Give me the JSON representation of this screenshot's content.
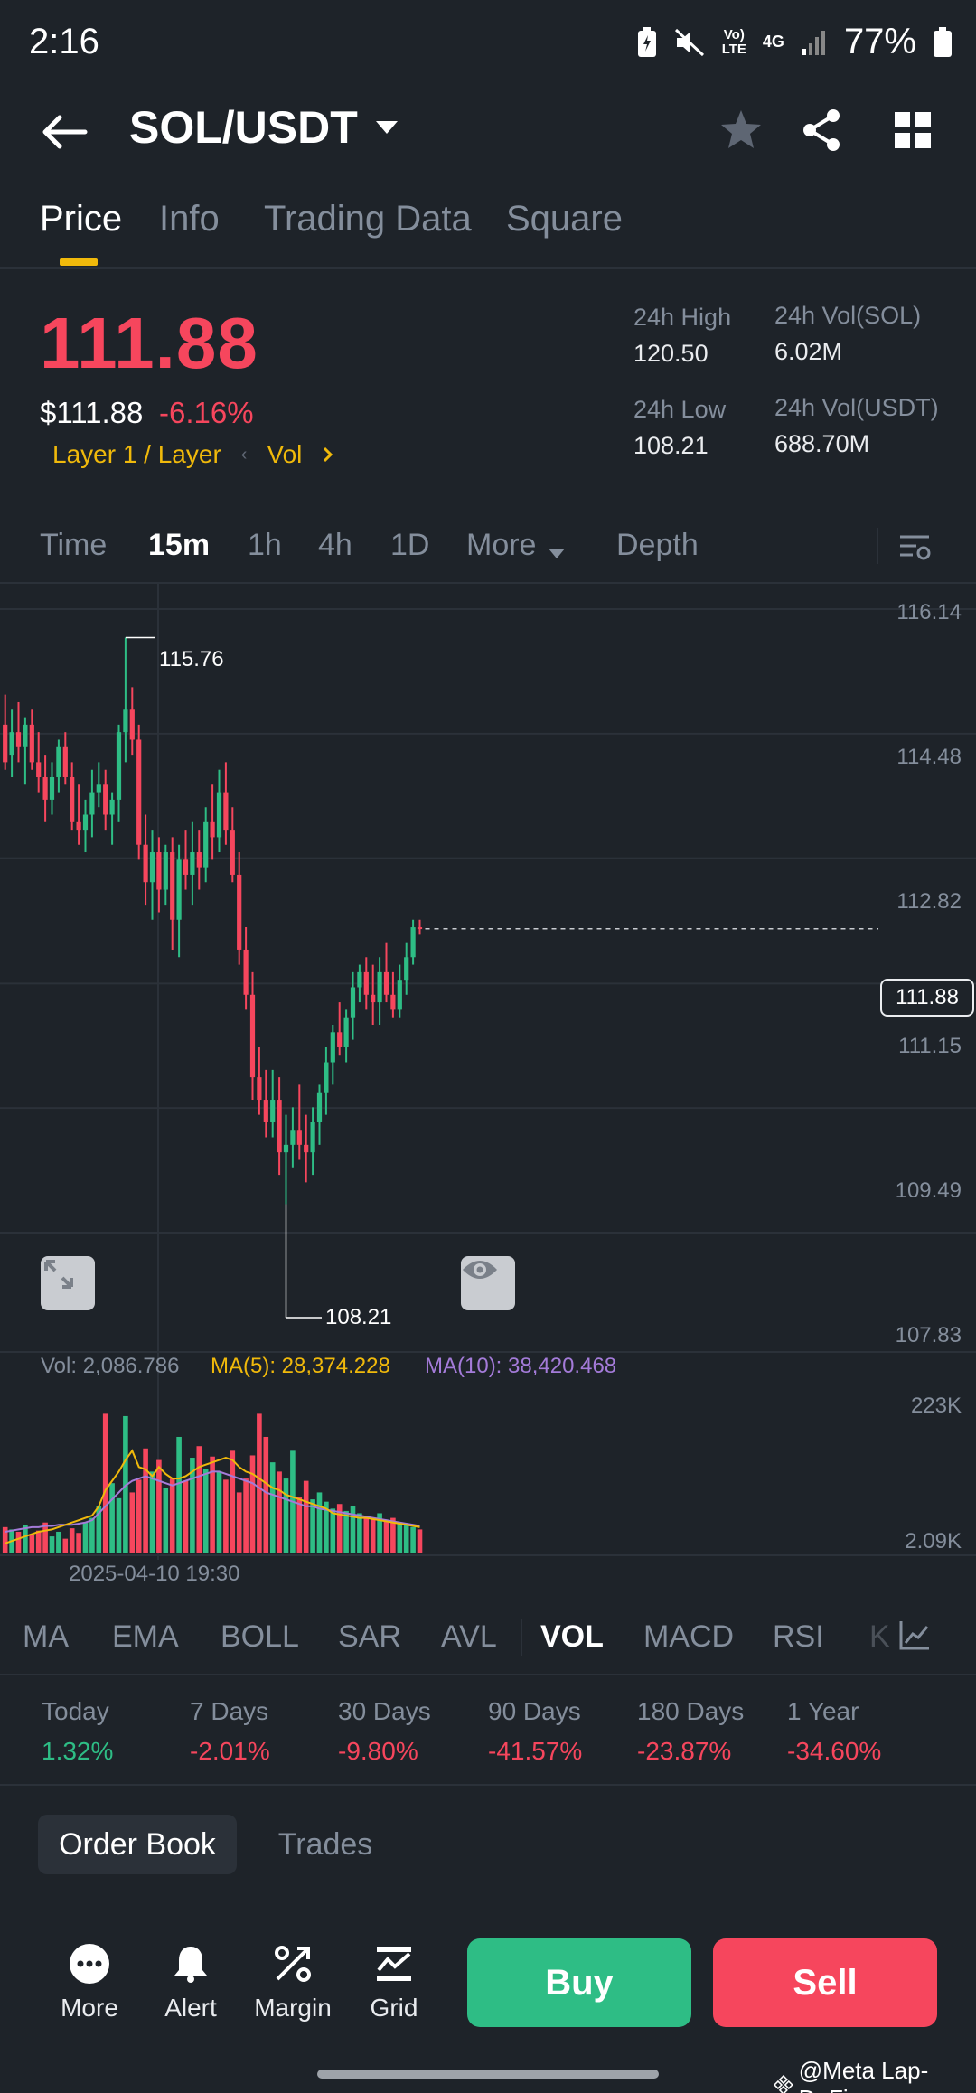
{
  "status_bar": {
    "time": "2:16",
    "battery": "77%",
    "network": "4G",
    "volte": "Vo) LTE"
  },
  "header": {
    "pair": "SOL/USDT"
  },
  "tabs": [
    {
      "label": "Price"
    },
    {
      "label": "Info"
    },
    {
      "label": "Trading Data"
    },
    {
      "label": "Square"
    }
  ],
  "price": {
    "last": "111.88",
    "usd": "$111.88",
    "change": "-6.16%",
    "tag_layer": "Layer 1 / Layer",
    "tag_vol": "Vol"
  },
  "stats": {
    "high_label": "24h High",
    "high": "120.50",
    "low_label": "24h Low",
    "low": "108.21",
    "vol_sol_label": "24h Vol(SOL)",
    "vol_sol": "6.02M",
    "vol_usdt_label": "24h Vol(USDT)",
    "vol_usdt": "688.70M"
  },
  "intervals": [
    "Time",
    "15m",
    "1h",
    "4h",
    "1D",
    "More",
    "Depth"
  ],
  "chart": {
    "y_labels": [
      "116.14",
      "114.48",
      "112.82",
      "111.15",
      "109.49",
      "107.83"
    ],
    "current_price_tag": "111.88",
    "high_marker": "115.76",
    "low_marker": "108.21",
    "vol_label": "Vol: 2,086.786",
    "ma5_label": "MA(5): 28,374.228",
    "ma10_label": "MA(10): 38,420.468",
    "vol_axis_top": "223K",
    "vol_axis_bottom": "2.09K",
    "date": "2025-04-10 19:30",
    "colors": {
      "up": "#2ebd85",
      "down": "#f6465d",
      "ma5": "#f0b90b",
      "ma10": "#a47bd9"
    }
  },
  "chart_data": {
    "type": "candlestick",
    "ylim": [
      107.83,
      116.14
    ],
    "candles": [
      {
        "o": 114.6,
        "h": 115.0,
        "l": 114.0,
        "c": 114.1
      },
      {
        "o": 114.2,
        "h": 114.8,
        "l": 113.9,
        "c": 114.5
      },
      {
        "o": 114.5,
        "h": 114.9,
        "l": 114.1,
        "c": 114.3
      },
      {
        "o": 114.3,
        "h": 114.7,
        "l": 113.8,
        "c": 114.6
      },
      {
        "o": 114.6,
        "h": 114.8,
        "l": 114.0,
        "c": 114.1
      },
      {
        "o": 114.1,
        "h": 114.5,
        "l": 113.7,
        "c": 113.9
      },
      {
        "o": 113.9,
        "h": 114.2,
        "l": 113.3,
        "c": 113.6
      },
      {
        "o": 113.6,
        "h": 114.1,
        "l": 113.4,
        "c": 113.9
      },
      {
        "o": 113.9,
        "h": 114.4,
        "l": 113.7,
        "c": 114.3
      },
      {
        "o": 114.3,
        "h": 114.5,
        "l": 113.8,
        "c": 113.9
      },
      {
        "o": 113.9,
        "h": 114.1,
        "l": 113.2,
        "c": 113.3
      },
      {
        "o": 113.3,
        "h": 113.8,
        "l": 113.0,
        "c": 113.2
      },
      {
        "o": 113.2,
        "h": 113.6,
        "l": 112.9,
        "c": 113.4
      },
      {
        "o": 113.4,
        "h": 114.0,
        "l": 113.1,
        "c": 113.7
      },
      {
        "o": 113.7,
        "h": 114.1,
        "l": 113.5,
        "c": 113.8
      },
      {
        "o": 113.8,
        "h": 114.0,
        "l": 113.2,
        "c": 113.4
      },
      {
        "o": 113.4,
        "h": 113.7,
        "l": 113.0,
        "c": 113.6
      },
      {
        "o": 113.6,
        "h": 114.6,
        "l": 113.3,
        "c": 114.5
      },
      {
        "o": 114.5,
        "h": 115.76,
        "l": 114.1,
        "c": 114.8
      },
      {
        "o": 114.8,
        "h": 115.1,
        "l": 114.2,
        "c": 114.4
      },
      {
        "o": 114.4,
        "h": 114.6,
        "l": 112.8,
        "c": 113.0
      },
      {
        "o": 113.0,
        "h": 113.4,
        "l": 112.2,
        "c": 112.5
      },
      {
        "o": 112.5,
        "h": 113.2,
        "l": 112.0,
        "c": 112.9
      },
      {
        "o": 112.9,
        "h": 113.1,
        "l": 112.1,
        "c": 112.4
      },
      {
        "o": 112.4,
        "h": 113.0,
        "l": 112.2,
        "c": 112.9
      },
      {
        "o": 112.9,
        "h": 113.1,
        "l": 111.6,
        "c": 112.0
      },
      {
        "o": 112.0,
        "h": 113.0,
        "l": 111.5,
        "c": 112.8
      },
      {
        "o": 112.8,
        "h": 113.2,
        "l": 112.4,
        "c": 112.6
      },
      {
        "o": 112.6,
        "h": 113.3,
        "l": 112.2,
        "c": 112.9
      },
      {
        "o": 112.9,
        "h": 113.2,
        "l": 112.4,
        "c": 112.7
      },
      {
        "o": 112.7,
        "h": 113.5,
        "l": 112.5,
        "c": 113.3
      },
      {
        "o": 113.3,
        "h": 113.8,
        "l": 112.8,
        "c": 113.1
      },
      {
        "o": 113.1,
        "h": 114.0,
        "l": 112.9,
        "c": 113.7
      },
      {
        "o": 113.7,
        "h": 114.1,
        "l": 113.0,
        "c": 113.2
      },
      {
        "o": 113.2,
        "h": 113.5,
        "l": 112.5,
        "c": 112.6
      },
      {
        "o": 112.6,
        "h": 112.9,
        "l": 111.4,
        "c": 111.6
      },
      {
        "o": 111.6,
        "h": 111.9,
        "l": 110.8,
        "c": 111.0
      },
      {
        "o": 111.0,
        "h": 111.3,
        "l": 109.6,
        "c": 109.9
      },
      {
        "o": 109.9,
        "h": 110.3,
        "l": 109.4,
        "c": 109.6
      },
      {
        "o": 109.6,
        "h": 110.0,
        "l": 109.1,
        "c": 109.3
      },
      {
        "o": 109.3,
        "h": 110.0,
        "l": 109.1,
        "c": 109.6
      },
      {
        "o": 109.6,
        "h": 109.9,
        "l": 108.6,
        "c": 108.9
      },
      {
        "o": 108.9,
        "h": 109.4,
        "l": 108.21,
        "c": 109.0
      },
      {
        "o": 109.0,
        "h": 109.5,
        "l": 108.7,
        "c": 109.2
      },
      {
        "o": 109.2,
        "h": 109.8,
        "l": 108.8,
        "c": 109.0
      },
      {
        "o": 109.0,
        "h": 109.4,
        "l": 108.5,
        "c": 108.9
      },
      {
        "o": 108.9,
        "h": 109.5,
        "l": 108.6,
        "c": 109.3
      },
      {
        "o": 109.3,
        "h": 109.8,
        "l": 109.0,
        "c": 109.7
      },
      {
        "o": 109.7,
        "h": 110.3,
        "l": 109.4,
        "c": 110.1
      },
      {
        "o": 110.1,
        "h": 110.6,
        "l": 109.8,
        "c": 110.5
      },
      {
        "o": 110.5,
        "h": 110.9,
        "l": 110.2,
        "c": 110.3
      },
      {
        "o": 110.3,
        "h": 110.8,
        "l": 110.1,
        "c": 110.7
      },
      {
        "o": 110.7,
        "h": 111.3,
        "l": 110.4,
        "c": 111.1
      },
      {
        "o": 111.1,
        "h": 111.4,
        "l": 110.9,
        "c": 111.3
      },
      {
        "o": 111.3,
        "h": 111.5,
        "l": 110.8,
        "c": 111.0
      },
      {
        "o": 111.0,
        "h": 111.4,
        "l": 110.6,
        "c": 110.9
      },
      {
        "o": 110.9,
        "h": 111.5,
        "l": 110.6,
        "c": 111.3
      },
      {
        "o": 111.3,
        "h": 111.7,
        "l": 110.9,
        "c": 111.0
      },
      {
        "o": 111.0,
        "h": 111.3,
        "l": 110.7,
        "c": 110.8
      },
      {
        "o": 110.8,
        "h": 111.4,
        "l": 110.7,
        "c": 111.2
      },
      {
        "o": 111.2,
        "h": 111.7,
        "l": 111.0,
        "c": 111.5
      },
      {
        "o": 111.5,
        "h": 112.0,
        "l": 111.4,
        "c": 111.9
      },
      {
        "o": 111.9,
        "h": 112.0,
        "l": 111.8,
        "c": 111.88
      }
    ],
    "volume_ylim": [
      2.09,
      223
    ],
    "volumes": [
      22,
      20,
      18,
      24,
      15,
      19,
      26,
      14,
      18,
      12,
      21,
      17,
      26,
      30,
      40,
      120,
      60,
      47,
      118,
      52,
      63,
      90,
      70,
      80,
      56,
      64,
      100,
      62,
      82,
      92,
      72,
      83,
      70,
      63,
      88,
      52,
      64,
      84,
      120,
      100,
      78,
      70,
      64,
      88,
      48,
      62,
      46,
      52,
      44,
      38,
      42,
      36,
      40,
      34,
      32,
      30,
      34,
      28,
      30,
      26,
      24,
      22,
      20
    ],
    "ma5": [
      8,
      10,
      12,
      14,
      16,
      18,
      19,
      20,
      22,
      24,
      26,
      28,
      30,
      32,
      40,
      54,
      62,
      70,
      80,
      88,
      74,
      72,
      66,
      74,
      68,
      64,
      64,
      66,
      70,
      74,
      76,
      78,
      80,
      82,
      80,
      74,
      70,
      68,
      64,
      60,
      56,
      54,
      50,
      48,
      46,
      44,
      42,
      40,
      38,
      34,
      33,
      32,
      31,
      30,
      30,
      29,
      28,
      27,
      26,
      25,
      24,
      23,
      22
    ],
    "ma10": [
      18,
      19,
      20,
      21,
      22,
      22,
      23,
      23,
      24,
      24,
      24,
      25,
      26,
      28,
      34,
      40,
      46,
      52,
      58,
      62,
      64,
      66,
      64,
      62,
      60,
      58,
      60,
      62,
      64,
      66,
      68,
      70,
      70,
      68,
      66,
      64,
      62,
      60,
      56,
      52,
      50,
      48,
      46,
      44,
      42,
      40,
      40,
      38,
      37,
      36,
      35,
      34,
      33,
      32,
      31,
      30,
      29,
      28,
      27,
      26,
      25,
      24,
      23
    ]
  },
  "indicators": [
    "MA",
    "EMA",
    "BOLL",
    "SAR",
    "AVL",
    "VOL",
    "MACD",
    "RSI",
    "K"
  ],
  "performance": [
    {
      "label": "Today",
      "value": "1.32%",
      "dir": "up"
    },
    {
      "label": "7 Days",
      "value": "-2.01%",
      "dir": "down"
    },
    {
      "label": "30 Days",
      "value": "-9.80%",
      "dir": "down"
    },
    {
      "label": "90 Days",
      "value": "-41.57%",
      "dir": "down"
    },
    {
      "label": "180 Days",
      "value": "-23.87%",
      "dir": "down"
    },
    {
      "label": "1 Year",
      "value": "-34.60%",
      "dir": "down"
    }
  ],
  "order_tabs": {
    "order_book": "Order Book",
    "trades": "Trades"
  },
  "bottom_bar": {
    "more": "More",
    "alert": "Alert",
    "margin": "Margin",
    "grid": "Grid",
    "buy": "Buy",
    "sell": "Sell"
  },
  "watermark": "@Meta Lap-DeFi"
}
